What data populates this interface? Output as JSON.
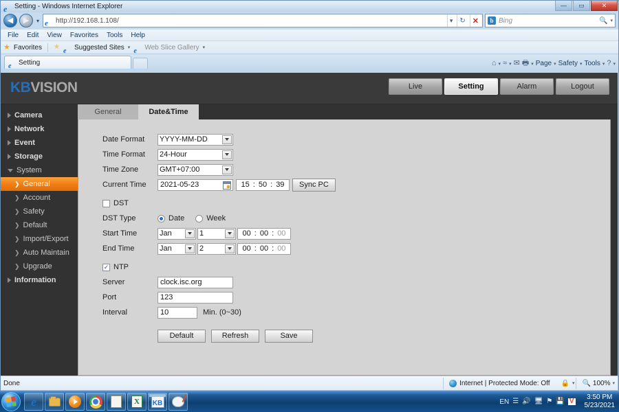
{
  "window": {
    "title": "Setting - Windows Internet Explorer",
    "minimize_label": "—",
    "maximize_label": "▭",
    "close_label": "✕"
  },
  "browser": {
    "back_label": "◀",
    "forward_label": "▶",
    "recent_caret": "▾",
    "address_value": "http://192.168.1.108/",
    "address_dropdown": "▾",
    "refresh_label": "↻",
    "stop_label": "✕",
    "search_brand": "b",
    "search_placeholder": "Bing",
    "search_dropdown": "▾",
    "menus": [
      "File",
      "Edit",
      "View",
      "Favorites",
      "Tools",
      "Help"
    ],
    "favorites": {
      "favorites_label": "Favorites",
      "suggested_sites": "Suggested Sites",
      "web_slice_gallery": "Web Slice Gallery",
      "caret": "▾"
    },
    "tab_label": "Setting",
    "commandbar": {
      "home": "⌂",
      "feeds": "≈",
      "mail": "✉",
      "print": "🖶",
      "page": "Page",
      "safety": "Safety",
      "tools": "Tools",
      "help": "?",
      "caret": "▾"
    }
  },
  "statusbar": {
    "left_text": "Done",
    "zone_text": "Internet | Protected Mode: Off",
    "zone_caret": "▾",
    "zoom_text": "100%",
    "zoom_caret": "▾"
  },
  "page": {
    "logo": {
      "kb": "KB",
      "vision": "VISION"
    },
    "navtabs": [
      {
        "label": "Live",
        "active": false
      },
      {
        "label": "Setting",
        "active": true
      },
      {
        "label": "Alarm",
        "active": false
      },
      {
        "label": "Logout",
        "active": false
      }
    ],
    "sidebar": [
      {
        "label": "Camera",
        "type": "top",
        "expanded": false
      },
      {
        "label": "Network",
        "type": "top",
        "expanded": false
      },
      {
        "label": "Event",
        "type": "top",
        "expanded": false
      },
      {
        "label": "Storage",
        "type": "top",
        "expanded": false
      },
      {
        "label": "System",
        "type": "top",
        "expanded": true
      },
      {
        "label": "General",
        "type": "sub",
        "active": true
      },
      {
        "label": "Account",
        "type": "sub",
        "active": false
      },
      {
        "label": "Safety",
        "type": "sub",
        "active": false
      },
      {
        "label": "Default",
        "type": "sub",
        "active": false
      },
      {
        "label": "Import/Export",
        "type": "sub",
        "active": false
      },
      {
        "label": "Auto Maintain",
        "type": "sub",
        "active": false
      },
      {
        "label": "Upgrade",
        "type": "sub",
        "active": false
      },
      {
        "label": "Information",
        "type": "top",
        "expanded": false
      }
    ],
    "content_tabs": [
      {
        "label": "General",
        "active": false
      },
      {
        "label": "Date&Time",
        "active": true
      }
    ],
    "form": {
      "date_format_label": "Date Format",
      "date_format_value": "YYYY-MM-DD",
      "time_format_label": "Time Format",
      "time_format_value": "24-Hour",
      "time_zone_label": "Time Zone",
      "time_zone_value": "GMT+07:00",
      "current_time_label": "Current Time",
      "current_date_value": "2021-05-23",
      "current_time_hh": "15",
      "current_time_mm": "50",
      "current_time_ss": "39",
      "time_sep": ":",
      "sync_pc_label": "Sync PC",
      "dst_label": "DST",
      "dst_checked": false,
      "dst_type_label": "DST Type",
      "dst_type_date": "Date",
      "dst_type_week": "Week",
      "dst_type_selected": "Date",
      "start_time_label": "Start Time",
      "start_month": "Jan",
      "start_day": "1",
      "start_hh": "00",
      "start_mm": "00",
      "start_ss": "00",
      "end_time_label": "End Time",
      "end_month": "Jan",
      "end_day": "2",
      "end_hh": "00",
      "end_mm": "00",
      "end_ss": "00",
      "ntp_label": "NTP",
      "ntp_checked": true,
      "server_label": "Server",
      "server_value": "clock.isc.org",
      "port_label": "Port",
      "port_value": "123",
      "interval_label": "Interval",
      "interval_value": "10",
      "interval_hint": "Min. (0~30)",
      "default_button": "Default",
      "refresh_button": "Refresh",
      "save_button": "Save"
    }
  },
  "taskbar": {
    "start_label": "Start",
    "items": [
      "internet-explorer",
      "windows-explorer",
      "media-player",
      "google-chrome",
      "notepad-app",
      "excel",
      "kbvision-app",
      "paint"
    ],
    "tray": {
      "language": "EN",
      "network_icon": "signal",
      "volume_icon": "volume-muted",
      "monitor_icon": "display",
      "security_icon": "action-center",
      "device_icon": "removable",
      "av_icon": "V",
      "time": "3:50 PM",
      "date": "5/23/2021"
    }
  },
  "colors": {
    "accent_orange": "#f07c12",
    "brand_blue": "#1f6fc4",
    "page_dark": "#323232",
    "panel_gray": "#d4d4d4"
  }
}
